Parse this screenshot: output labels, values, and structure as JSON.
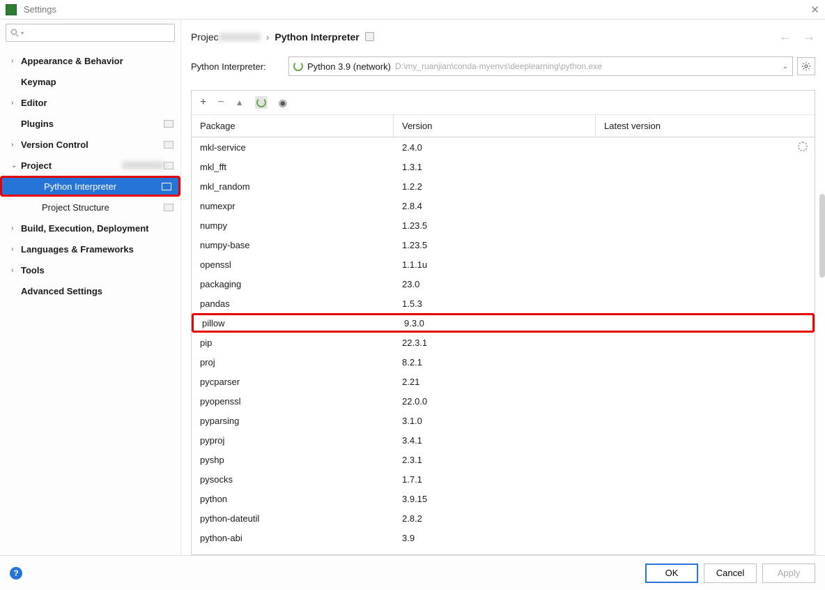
{
  "window": {
    "title": "Settings"
  },
  "sidebar": {
    "items": [
      {
        "label": "Appearance & Behavior",
        "bold": true,
        "arrow": ">",
        "chip": false
      },
      {
        "label": "Keymap",
        "bold": true,
        "arrow": "",
        "chip": false
      },
      {
        "label": "Editor",
        "bold": true,
        "arrow": ">",
        "chip": false
      },
      {
        "label": "Plugins",
        "bold": true,
        "arrow": "",
        "chip": true
      },
      {
        "label": "Version Control",
        "bold": true,
        "arrow": ">",
        "chip": true
      },
      {
        "label": "Project",
        "bold": true,
        "arrow": "v",
        "chip": true,
        "blur": true
      },
      {
        "label": "Python Interpreter",
        "bold": false,
        "arrow": "",
        "chip": true,
        "indent": true,
        "selected": true,
        "redbox": true
      },
      {
        "label": "Project Structure",
        "bold": false,
        "arrow": "",
        "chip": true,
        "indent": true
      },
      {
        "label": "Build, Execution, Deployment",
        "bold": true,
        "arrow": ">",
        "chip": false
      },
      {
        "label": "Languages & Frameworks",
        "bold": true,
        "arrow": ">",
        "chip": false
      },
      {
        "label": "Tools",
        "bold": true,
        "arrow": ">",
        "chip": false
      },
      {
        "label": "Advanced Settings",
        "bold": true,
        "arrow": "",
        "chip": false
      }
    ]
  },
  "breadcrumb": {
    "root": "Projec",
    "leaf": "Python Interpreter",
    "sep": "›"
  },
  "interpreter": {
    "label": "Python Interpreter:",
    "name": "Python 3.9 (network)",
    "path": "D:\\my_ruanjian\\conda-myenvs\\deeplearning\\python.exe"
  },
  "columns": {
    "c1": "Package",
    "c2": "Version",
    "c3": "Latest version"
  },
  "packages": [
    {
      "name": "mkl-service",
      "version": "2.4.0"
    },
    {
      "name": "mkl_fft",
      "version": "1.3.1"
    },
    {
      "name": "mkl_random",
      "version": "1.2.2"
    },
    {
      "name": "numexpr",
      "version": "2.8.4"
    },
    {
      "name": "numpy",
      "version": "1.23.5"
    },
    {
      "name": "numpy-base",
      "version": "1.23.5"
    },
    {
      "name": "openssl",
      "version": "1.1.1u"
    },
    {
      "name": "packaging",
      "version": "23.0"
    },
    {
      "name": "pandas",
      "version": "1.5.3"
    },
    {
      "name": "pillow",
      "version": "9.3.0",
      "hl": true
    },
    {
      "name": "pip",
      "version": "22.3.1"
    },
    {
      "name": "proj",
      "version": "8.2.1"
    },
    {
      "name": "pycparser",
      "version": "2.21"
    },
    {
      "name": "pyopenssl",
      "version": "22.0.0"
    },
    {
      "name": "pyparsing",
      "version": "3.1.0"
    },
    {
      "name": "pyproj",
      "version": "3.4.1"
    },
    {
      "name": "pyshp",
      "version": "2.3.1"
    },
    {
      "name": "pysocks",
      "version": "1.7.1"
    },
    {
      "name": "python",
      "version": "3.9.15"
    },
    {
      "name": "python-dateutil",
      "version": "2.8.2"
    },
    {
      "name": "python-abi",
      "version": "3.9"
    }
  ],
  "footer": {
    "ok": "OK",
    "cancel": "Cancel",
    "apply": "Apply"
  }
}
